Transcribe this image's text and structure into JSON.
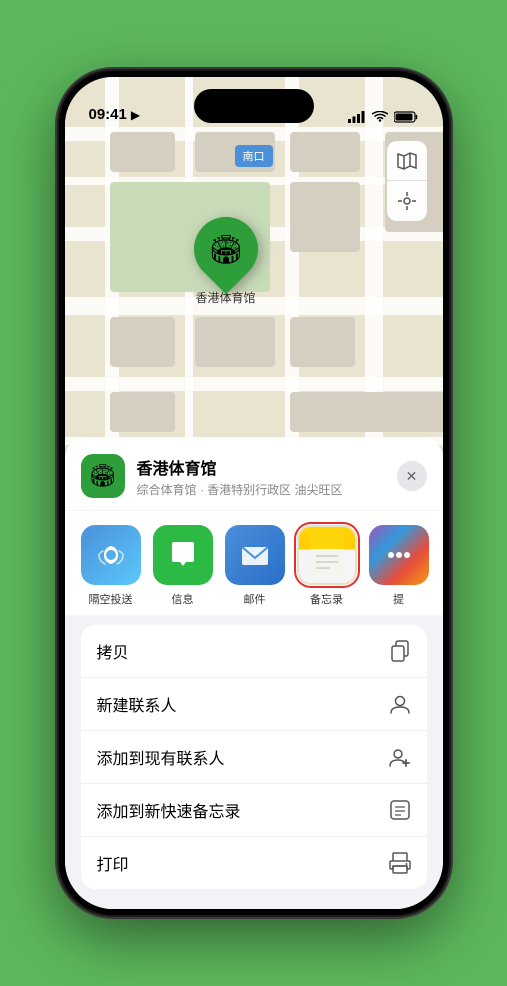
{
  "statusBar": {
    "time": "09:41",
    "locationArrow": "▶"
  },
  "map": {
    "locationLabel": "南口",
    "pinLabel": "香港体育馆"
  },
  "mapControls": {
    "mapIcon": "🗺",
    "locationIcon": "◎"
  },
  "sheet": {
    "venueIcon": "🏟",
    "venueName": "香港体育馆",
    "venueDesc": "综合体育馆 · 香港特别行政区 油尖旺区",
    "closeLabel": "✕"
  },
  "shareItems": [
    {
      "id": "airdrop",
      "label": "隔空投送",
      "icon": "📡"
    },
    {
      "id": "messages",
      "label": "信息",
      "icon": "💬"
    },
    {
      "id": "mail",
      "label": "邮件",
      "icon": "✉"
    },
    {
      "id": "notes",
      "label": "备忘录",
      "icon": "📝",
      "selected": true
    },
    {
      "id": "more",
      "label": "提",
      "icon": "…"
    }
  ],
  "actions": [
    {
      "label": "拷贝",
      "icon": "📋"
    },
    {
      "label": "新建联系人",
      "icon": "👤"
    },
    {
      "label": "添加到现有联系人",
      "icon": "👤"
    },
    {
      "label": "添加到新快速备忘录",
      "icon": "📝"
    },
    {
      "label": "打印",
      "icon": "🖨"
    }
  ]
}
